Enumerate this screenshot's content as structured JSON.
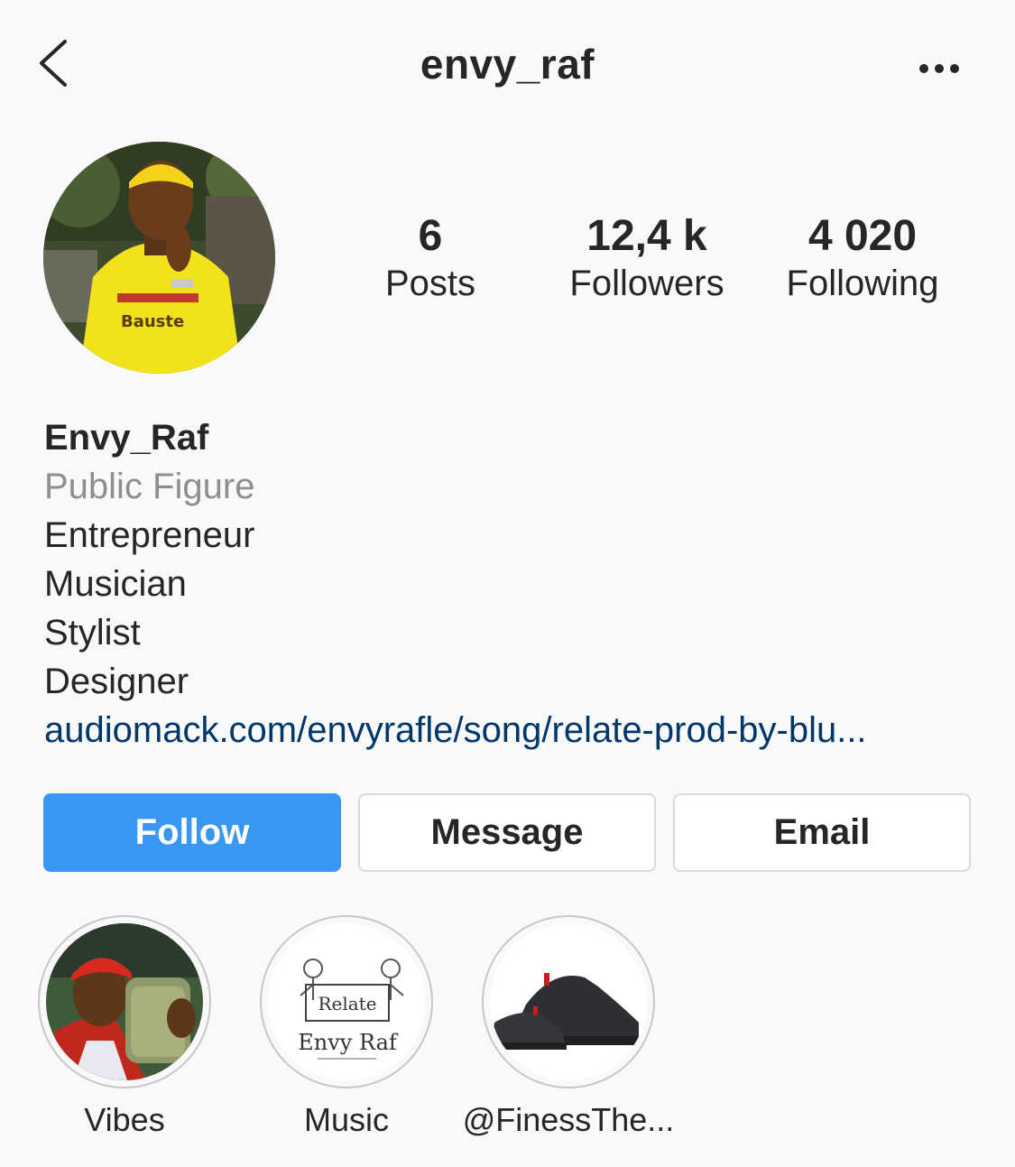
{
  "header": {
    "username": "envy_raf",
    "back_icon": "chevron-left-icon",
    "more_icon": "more-horizontal-icon"
  },
  "stats": {
    "posts": {
      "value": "6",
      "label": "Posts"
    },
    "followers": {
      "value": "12,4 k",
      "label": "Followers"
    },
    "following": {
      "value": "4 020",
      "label": "Following"
    }
  },
  "bio": {
    "name": "Envy_Raf",
    "category": "Public Figure",
    "lines": [
      "Entrepreneur",
      "Musician",
      "Stylist",
      "Designer"
    ],
    "link": "audiomack.com/envyrafle/song/relate-prod-by-blu..."
  },
  "actions": {
    "follow": "Follow",
    "message": "Message",
    "email": "Email"
  },
  "highlights": [
    {
      "label": "Vibes"
    },
    {
      "label": "Music",
      "cover_text": [
        "Relate",
        "Envy Raf"
      ]
    },
    {
      "label": "@FinessThe..."
    }
  ],
  "colors": {
    "accent": "#3897f0",
    "link": "#00376b",
    "muted": "#8e8e8e",
    "background": "#f9f9f9"
  }
}
